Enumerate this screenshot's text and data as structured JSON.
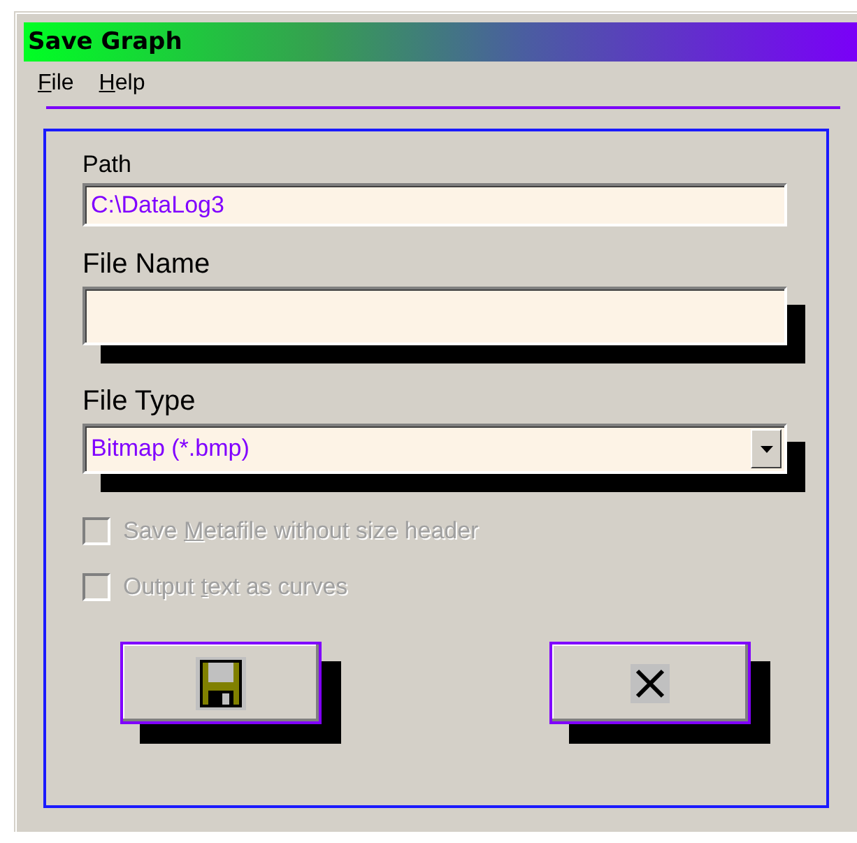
{
  "window": {
    "title": "Save Graph"
  },
  "menu": [
    {
      "key": "F",
      "rest": "ile"
    },
    {
      "key": "H",
      "rest": "elp"
    }
  ],
  "path": {
    "label": "Path",
    "value": "C:\\DataLog3"
  },
  "file_name": {
    "label": "File Name"
  },
  "file_type": {
    "label": "File Type",
    "value": "Bitmap (*.bmp)"
  },
  "options": [
    {
      "parts": [
        "Save ",
        "M",
        "etafile without size header"
      ],
      "checked": false,
      "disabled": true
    },
    {
      "parts": [
        "Output ",
        "t",
        "ext as curves"
      ],
      "checked": false,
      "disabled": true
    }
  ],
  "buttons": [
    {
      "kind": "save"
    },
    {
      "kind": "cancel"
    }
  ]
}
